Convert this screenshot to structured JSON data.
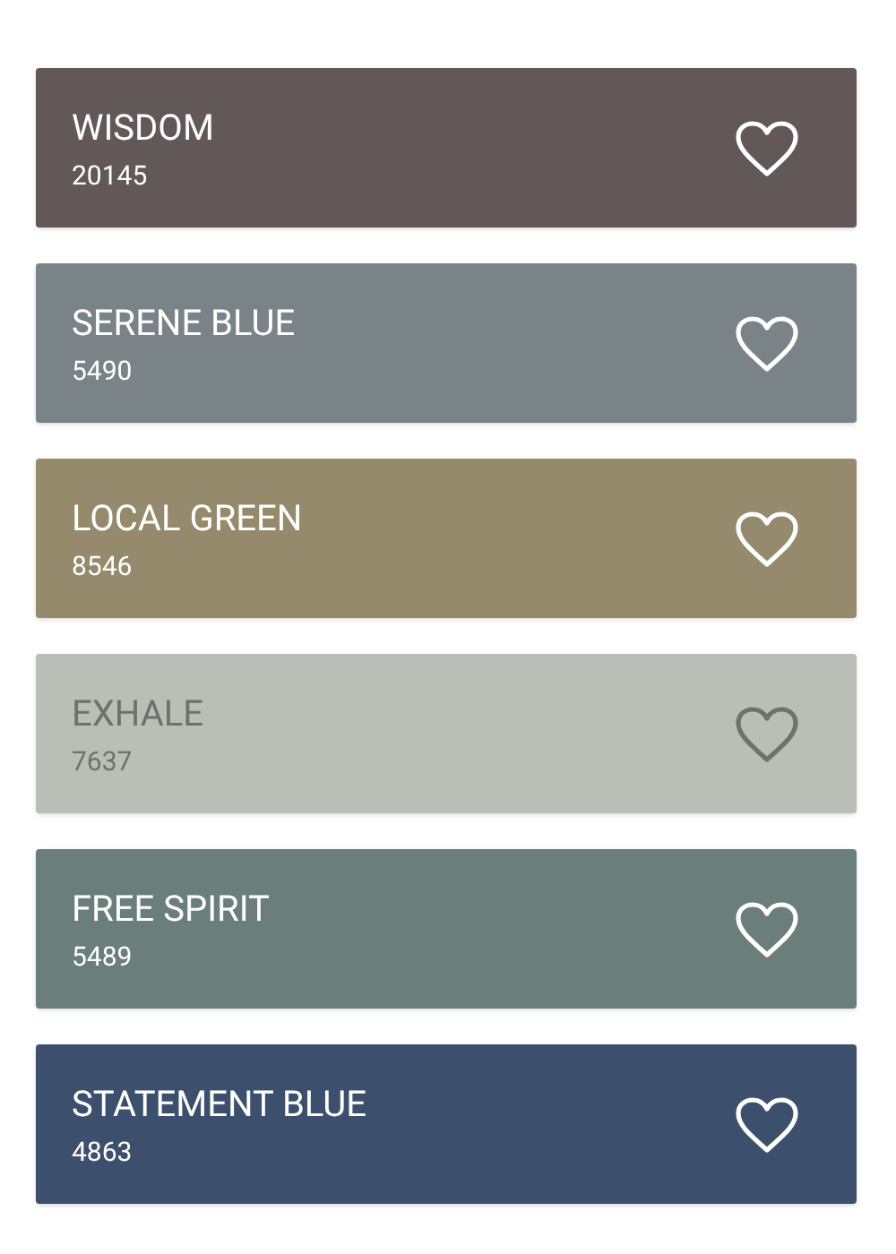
{
  "swatches": [
    {
      "name": "WISDOM",
      "code": "20145",
      "color": "#625857"
    },
    {
      "name": "SERENE BLUE",
      "code": "5490",
      "color": "#7a8388"
    },
    {
      "name": "LOCAL GREEN",
      "code": "8546",
      "color": "#958a6b"
    },
    {
      "name": "EXHALE",
      "code": "7637",
      "color": "#bbbeb6"
    },
    {
      "name": "FREE SPIRIT",
      "code": "5489",
      "color": "#6a7f7b"
    },
    {
      "name": "STATEMENT BLUE",
      "code": "4863",
      "color": "#3c506e"
    }
  ]
}
